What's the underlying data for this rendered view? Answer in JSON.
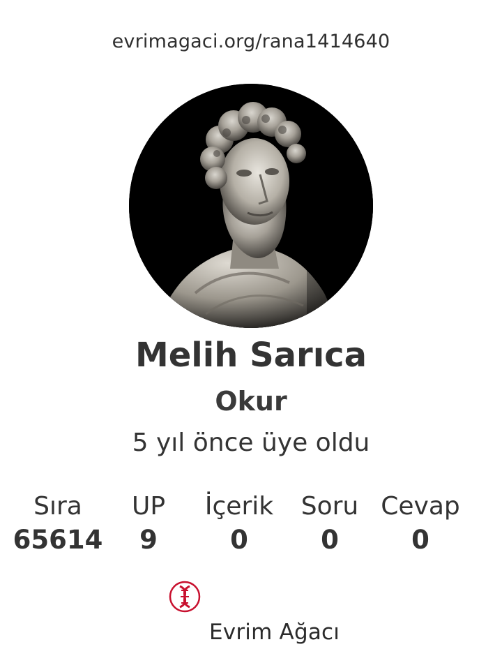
{
  "profile": {
    "url": "evrimagaci.org/rana1414640",
    "avatar_icon": "bust-portrait-image",
    "name": "Melih Sarıca",
    "role": "Okur",
    "joined": "5 yıl önce üye oldu"
  },
  "stats": [
    {
      "label": "Sıra",
      "value": "65614"
    },
    {
      "label": "UP",
      "value": "9"
    },
    {
      "label": "İçerik",
      "value": "0"
    },
    {
      "label": "Soru",
      "value": "0"
    },
    {
      "label": "Cevap",
      "value": "0"
    }
  ],
  "footer": {
    "logo_icon": "dna-helix-icon",
    "brand": "Evrim Ağacı"
  },
  "colors": {
    "text": "#333333",
    "logo_red": "#c8102e",
    "background": "#ffffff"
  }
}
